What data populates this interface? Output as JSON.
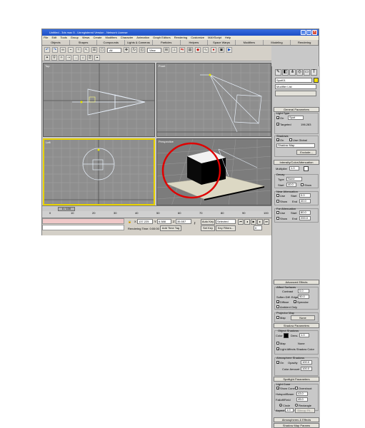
{
  "window": {
    "title": "Untitled - 3ds max 5 - Unregistered Version - Network License"
  },
  "menu": [
    "File",
    "Edit",
    "Tools",
    "Group",
    "Views",
    "Create",
    "Modifiers",
    "Character",
    "Animation",
    "Graph Editors",
    "Rendering",
    "Customize",
    "MAXScript",
    "Help"
  ],
  "command_tabs": [
    "Objects",
    "Shapes",
    "Compounds",
    "Lights & Cameras",
    "Particles",
    "Helpers",
    "Space Warps",
    "Modifiers",
    "Modeling",
    "Rendering"
  ],
  "toolbar": {
    "selection_filter": "All",
    "reference_coord": "View"
  },
  "viewports": {
    "top": "Top",
    "front": "Front",
    "left": "Left",
    "perspective": "Perspective"
  },
  "timeline": {
    "slider_label": "0 / 100",
    "ticks": [
      "0",
      "10",
      "20",
      "30",
      "40",
      "50",
      "60",
      "70",
      "80",
      "90",
      "100"
    ]
  },
  "status": {
    "x_label": "X",
    "x_value": "137.225",
    "y_label": "Y",
    "y_value": "6.588",
    "z_label": "Z",
    "z_value": "35.557",
    "rendering_time": "Rendering Time: 0:00:00",
    "add_time_tag": "Add Time Tag",
    "auto_key": "Auto Key",
    "selected": "Selected",
    "set_key": "Set Key",
    "key_filters": "Key Filters...",
    "frame": "0"
  },
  "command_panel": {
    "object_name": "Spot01",
    "modifier_list": "Modifier List",
    "rollouts": {
      "general": "General Parameters",
      "intensity": "Intensity/Color/Attenuation",
      "advanced": "Advanced Effects",
      "shadow": "Shadow Parameters",
      "spotlight": "Spotlight Parameters",
      "atmospheres": "Atmospheres & Effects",
      "shadow_map": "Shadow Map Params"
    },
    "general": {
      "light_type": "Light Type",
      "on_label": "On",
      "type_value": "Spot",
      "targeted_label": "Targeted",
      "targeted_value": "196.283",
      "shadows": "Shadows",
      "shadows_on": "On",
      "use_global": "Use Global",
      "shadow_type": "Shadow Map",
      "exclude": "Exclude..."
    },
    "intensity": {
      "multiplier_label": "Multiplier",
      "multiplier": "1.0",
      "decay": "Decay",
      "type_label": "Type",
      "type_value": "None",
      "start_label": "Start",
      "start_value": "40.0",
      "show": "Show",
      "near_atten": "Near Attenuation",
      "use": "Use",
      "near_start": "0.0",
      "end_label": "End",
      "near_end": "40.0",
      "far_atten": "Far Attenuation",
      "far_start": "80.0",
      "far_end": "200.0"
    },
    "advanced": {
      "affect_surfaces": "Affect Surfaces",
      "contrast_label": "Contrast",
      "contrast": "0.0",
      "soften_label": "Soften Diff. Edge",
      "soften": "50.0",
      "diffuse": "Diffuse",
      "specular": "Specular",
      "ambient_only": "Ambient Only",
      "projector_map": "Projector Map",
      "map_label": "Map",
      "map_value": "None"
    },
    "shadow": {
      "object_shadows": "Object Shadows",
      "color_label": "Color",
      "dens_label": "Dens.",
      "dens": "1.0",
      "map_label": "Map",
      "map_value": "None",
      "light_affects": "Light Affects Shadow Color",
      "atmosphere_shadows": "Atmosphere Shadows",
      "on": "On",
      "opacity_label": "Opacity",
      "opacity": "100.0",
      "color_amount_label": "Color Amount",
      "color_amount": "100.0"
    },
    "spotlight": {
      "light_cone": "Light Cone",
      "show_cone": "Show Cone",
      "overshoot": "Overshoot",
      "hotspot_label": "Hotspot/Beam",
      "hotspot": "43.0",
      "falloff_label": "Falloff/Field",
      "falloff": "45.0",
      "circle": "Circle",
      "rectangle": "Rectangle",
      "aspect_label": "Aspect",
      "aspect": "1.0",
      "bitmap_fit": "Bitmap Fit..."
    }
  },
  "colors": {
    "viewport_bg": "#8e8e8e",
    "active_viewport": "#e8d200",
    "highlight_circle": "#e00000",
    "title_blue": "#1c4fc4"
  }
}
